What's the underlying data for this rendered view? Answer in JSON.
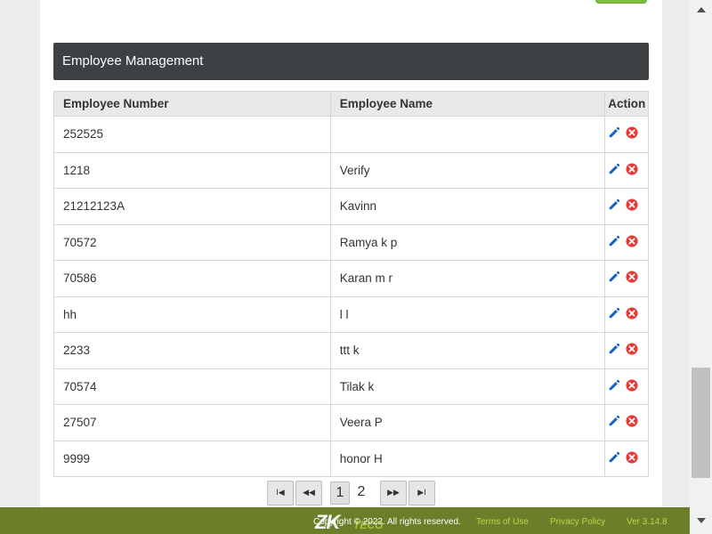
{
  "panel": {
    "title": "Employee Management"
  },
  "table": {
    "headers": [
      "Employee Number",
      "Employee Name",
      "Action"
    ],
    "rows": [
      {
        "number": "252525",
        "name": ""
      },
      {
        "number": "1218",
        "name": "Verify"
      },
      {
        "number": "21212123A",
        "name": "Kavinn"
      },
      {
        "number": "70572",
        "name": "Ramya k p"
      },
      {
        "number": "70586",
        "name": "Karan m r"
      },
      {
        "number": "hh",
        "name": "l l"
      },
      {
        "number": "2233",
        "name": "ttt k"
      },
      {
        "number": "70574",
        "name": "Tilak k"
      },
      {
        "number": "27507",
        "name": "Veera P"
      },
      {
        "number": "9999",
        "name": "honor H"
      }
    ]
  },
  "pagination": {
    "first_label": "I◀",
    "prev_label": "◀◀",
    "pages": [
      "1",
      "2"
    ],
    "current_page": "1",
    "next_label": "▶▶",
    "last_label": "▶I"
  },
  "footer": {
    "logo_text": "ZK",
    "logo_sub": "TECO",
    "copyright": "Copyright © 2022. All rights reserved.",
    "terms": "Terms of Use",
    "privacy": "Privacy Policy",
    "version": "Ver 3.14.8"
  },
  "colors": {
    "panel_heading_bg": "#3d4144",
    "footer_bg": "#6b7f2a",
    "footer_link": "#b9d84a",
    "edit_icon": "#1565c0",
    "delete_icon": "#e53935"
  },
  "icons": {
    "edit": "pencil-icon",
    "delete": "close-circle-icon"
  }
}
